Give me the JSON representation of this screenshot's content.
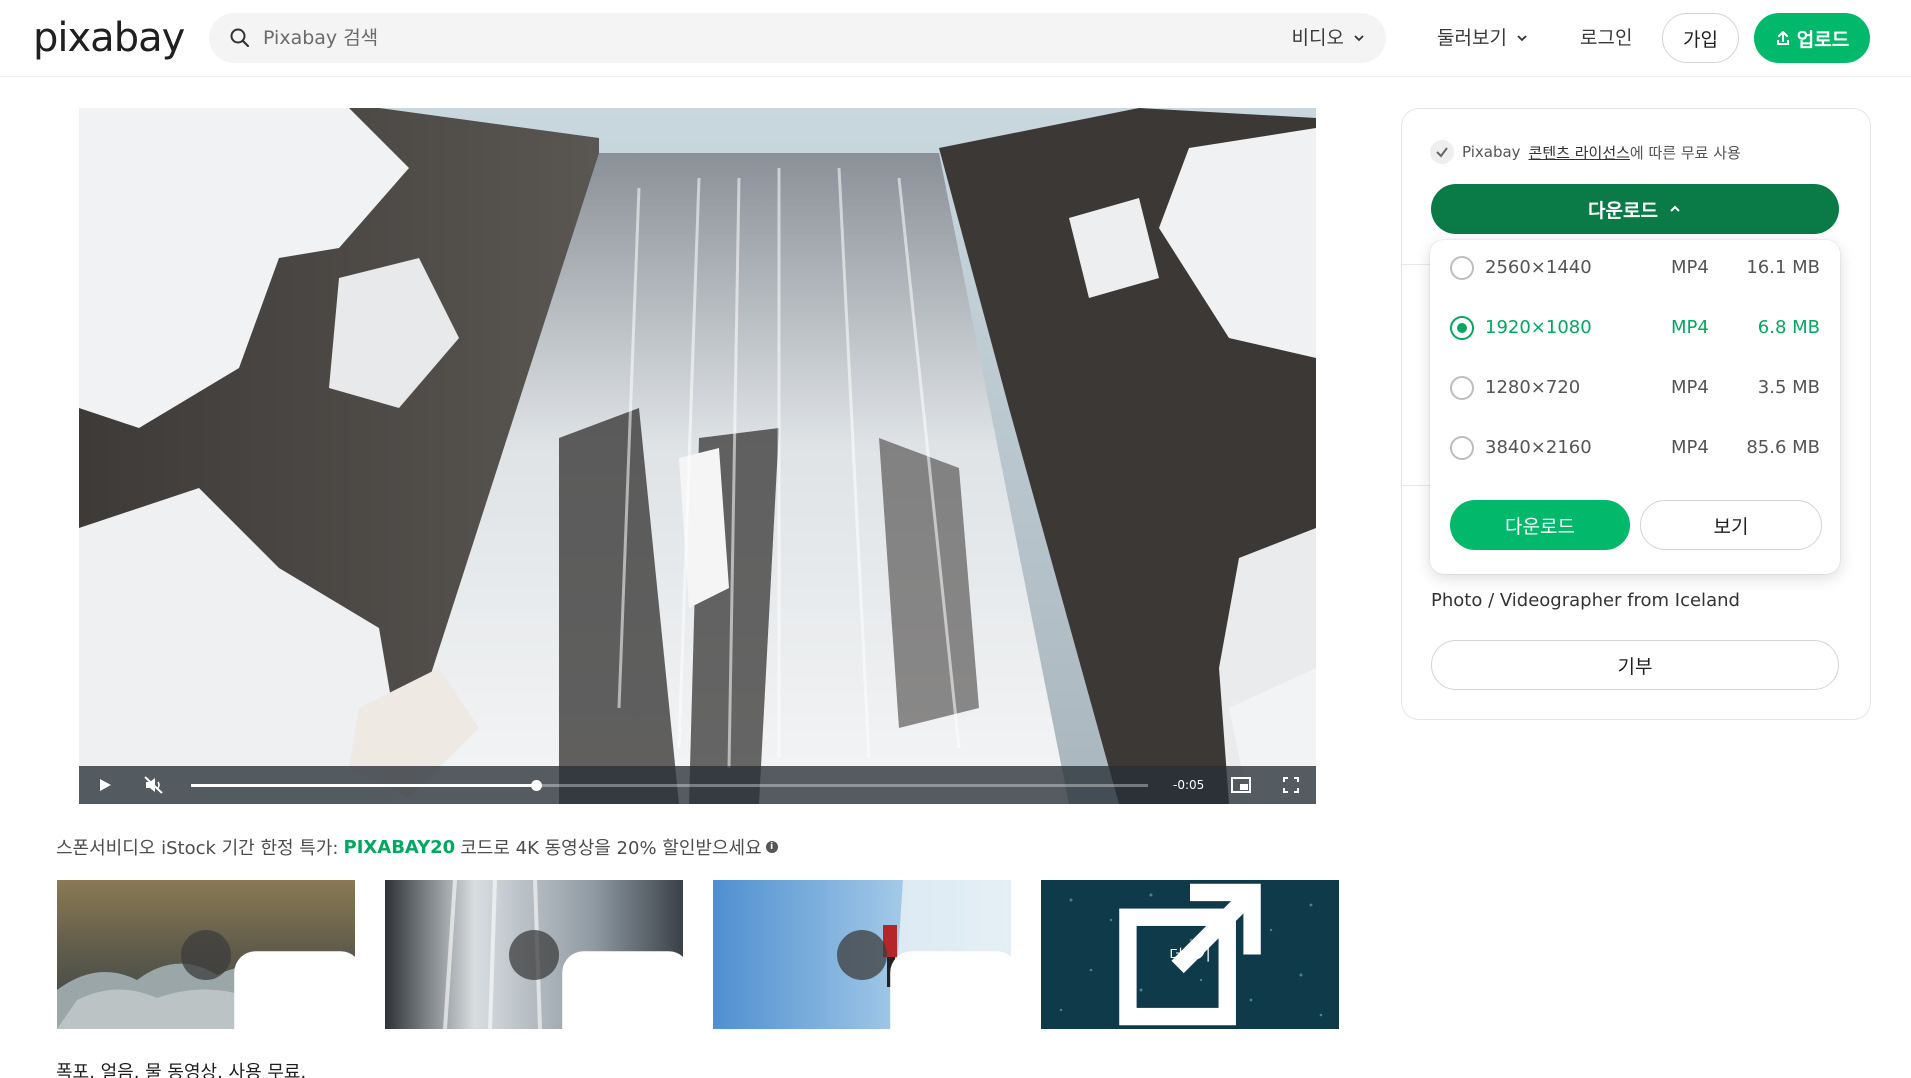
{
  "header": {
    "logo": "pixabay",
    "search_placeholder": "Pixabay 검색",
    "media_type": "비디오",
    "explore": "둘러보기",
    "login": "로그인",
    "join": "가입",
    "upload": "업로드"
  },
  "player": {
    "time": "-0:05",
    "progress": 0.36
  },
  "sponsor": {
    "prefix": "스폰서비디오 iStock 기간 한정 특가:",
    "code": "PIXABAY20",
    "suffix": "코드로 4K 동영상을 20% 할인받으세요"
  },
  "thumbs": {
    "more": "더보기"
  },
  "caption": "폭포, 얼음, 물 동영상. 사용 무료.",
  "sidebar": {
    "license_prefix": "Pixabay",
    "license_link": "콘텐츠 라이선스",
    "license_suffix": "에 따른 무료 사용",
    "download": "다운로드",
    "author_bio": "Photo / Videographer from Iceland",
    "donate": "기부"
  },
  "download_options": [
    {
      "resolution": "2560×1440",
      "format": "MP4",
      "size": "16.1 MB",
      "selected": false
    },
    {
      "resolution": "1920×1080",
      "format": "MP4",
      "size": "6.8 MB",
      "selected": true
    },
    {
      "resolution": "1280×720",
      "format": "MP4",
      "size": "3.5 MB",
      "selected": false
    },
    {
      "resolution": "3840×2160",
      "format": "MP4",
      "size": "85.6 MB",
      "selected": false
    }
  ],
  "dropdown_buttons": {
    "download": "다운로드",
    "view": "보기"
  },
  "colors": {
    "accent": "#02b86a",
    "accent_dark": "#0a7a47"
  }
}
